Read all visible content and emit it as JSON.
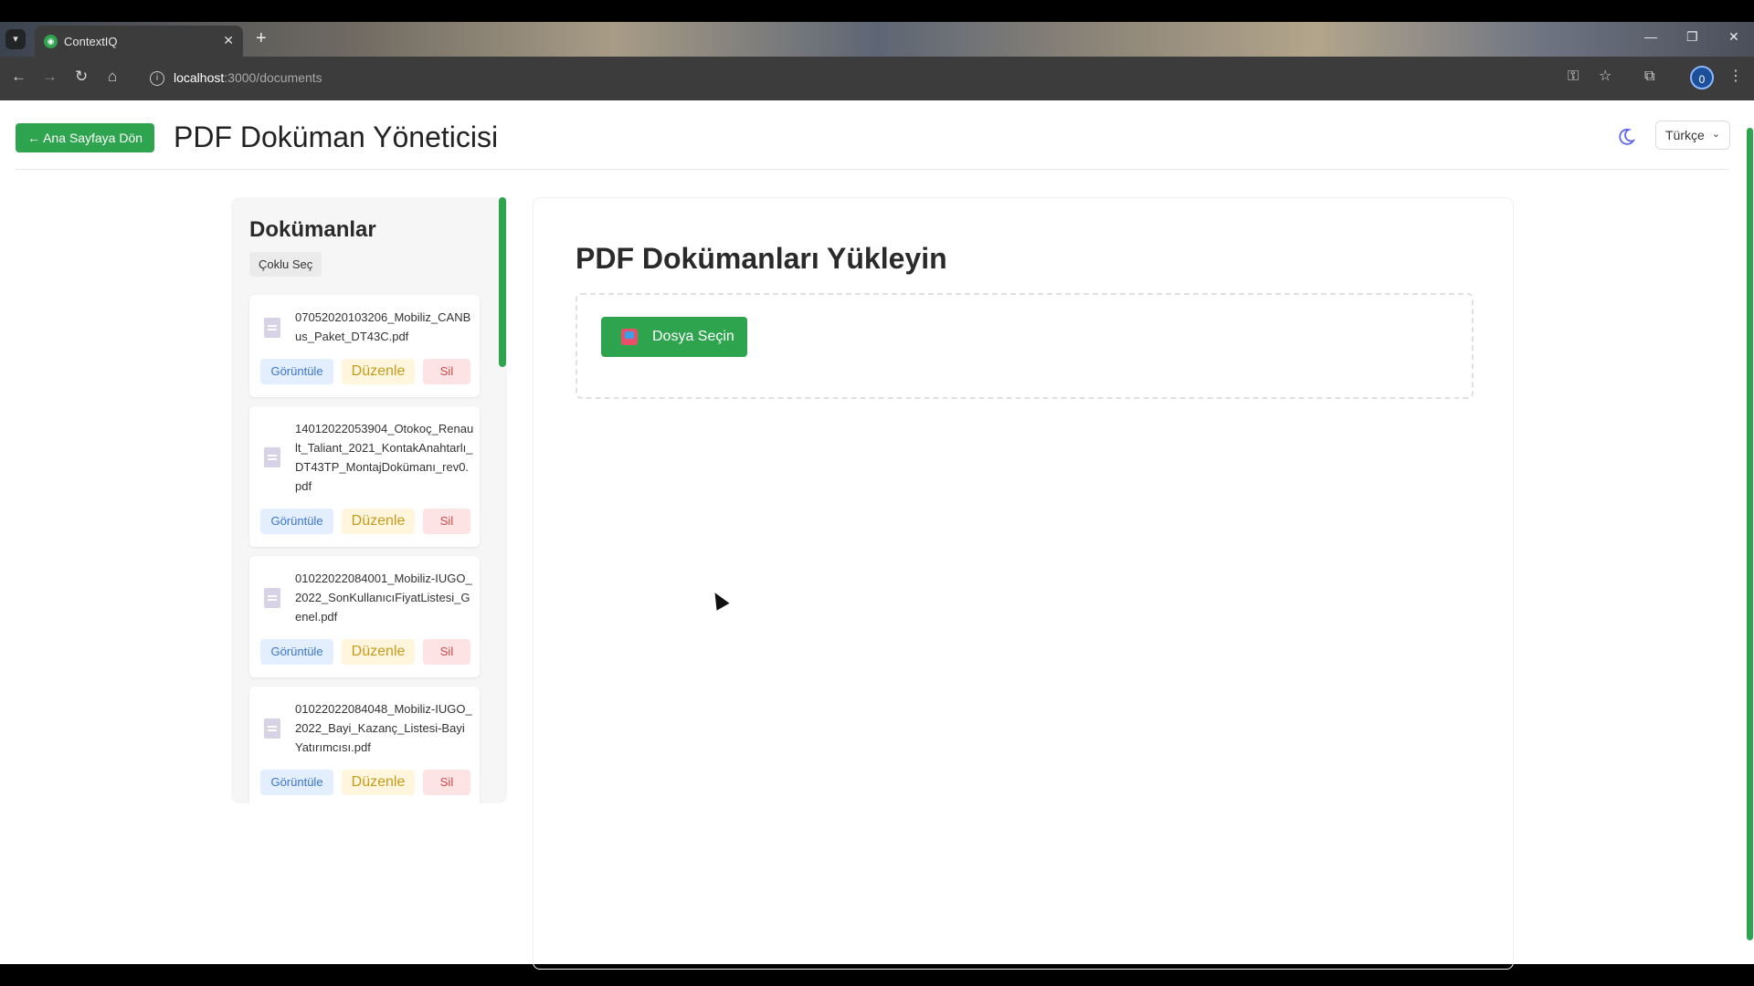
{
  "browser": {
    "tab_title": "ContextIQ",
    "tab_close": "✕",
    "new_tab": "+",
    "url_host": "localhost",
    "url_path": ":3000/documents",
    "profile_initial": "0",
    "window_controls": [
      "—",
      "❐",
      "✕"
    ]
  },
  "header": {
    "back_label": "← Ana Sayfaya Dön",
    "title": "PDF Doküman Yöneticisi",
    "theme_icon": "moon-icon",
    "language": "Türkçe"
  },
  "sidebar": {
    "title": "Dokümanlar",
    "multi_select_label": "Çoklu Seç",
    "documents": [
      {
        "name": "07052020103206_Mobiliz_CANBus_Paket_DT43C.pdf"
      },
      {
        "name": "14012022053904_Otokoç_Renault_Taliant_2021_KontakAnahtarlı_DT43TP_MontajDokümanı_rev0.pdf"
      },
      {
        "name": "01022022084001_Mobiliz-IUGO_2022_SonKullanıcıFiyatListesi_Genel.pdf"
      },
      {
        "name": "01022022084048_Mobiliz-IUGO_2022_Bayi_Kazanç_Listesi-Bayi Yatırımcısı.pdf"
      }
    ],
    "view_label": "Görüntüle",
    "edit_label": "Düzenle",
    "delete_label": "Sil"
  },
  "main": {
    "title": "PDF Dokümanları Yükleyin",
    "choose_file_label": "Dosya Seçin"
  },
  "colors": {
    "accent": "#2ea44f",
    "view": "#3b74d1",
    "edit": "#c89a1c",
    "delete": "#d24a4a"
  }
}
